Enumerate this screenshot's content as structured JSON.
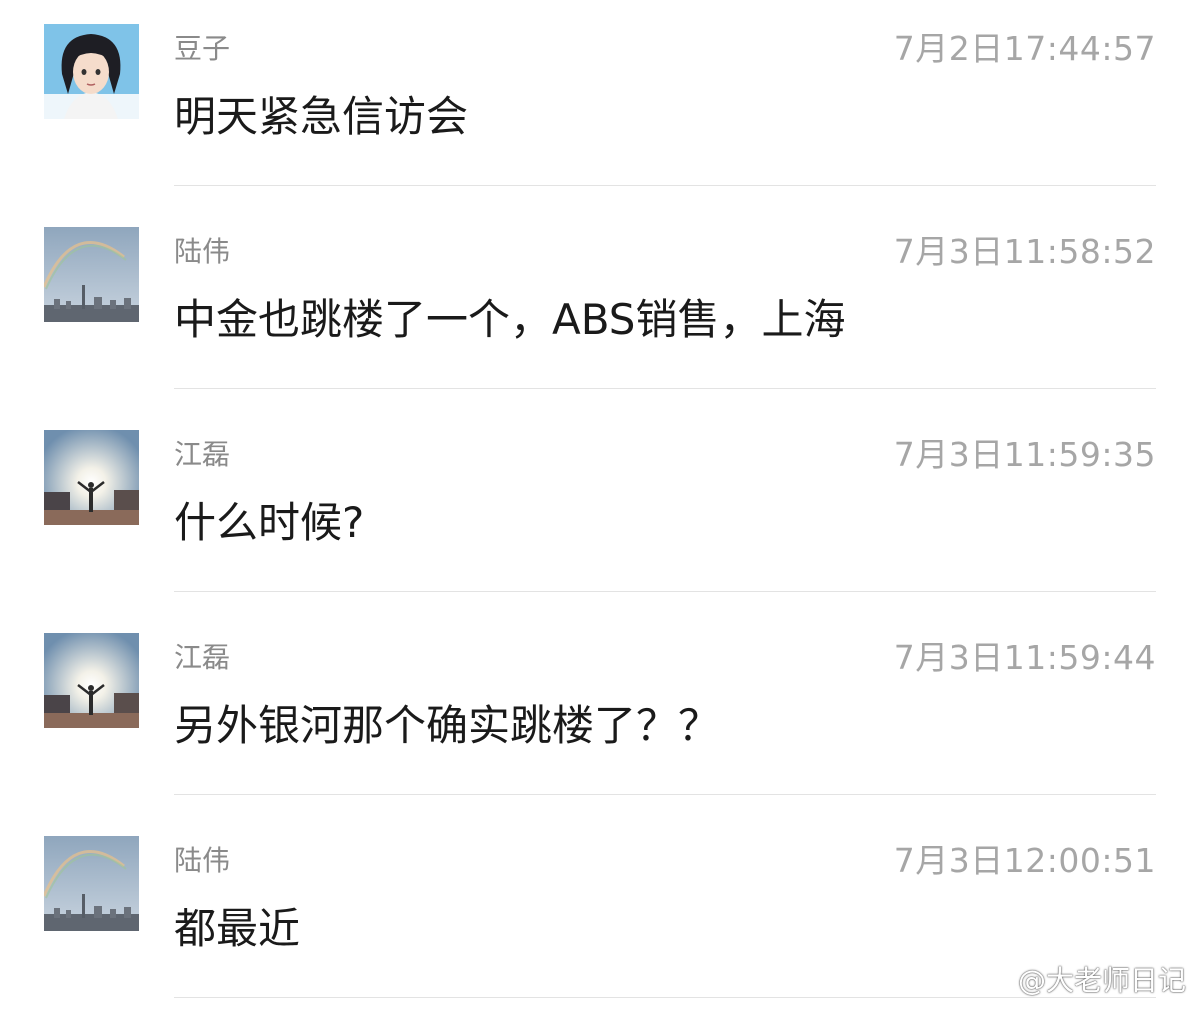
{
  "messages": [
    {
      "sender": "豆子",
      "time": "7月2日17:44:57",
      "text": "明天紧急信访会",
      "avatar": "anime-girl-avatar"
    },
    {
      "sender": "陆伟",
      "time": "7月3日11:58:52",
      "text": "中金也跳楼了一个，ABS销售，上海",
      "avatar": "rainbow-city-avatar"
    },
    {
      "sender": "江磊",
      "time": "7月3日11:59:35",
      "text": "什么时候?",
      "avatar": "sunset-person-avatar"
    },
    {
      "sender": "江磊",
      "time": "7月3日11:59:44",
      "text": "另外银河那个确实跳楼了？？",
      "avatar": "sunset-person-avatar"
    },
    {
      "sender": "陆伟",
      "time": "7月3日12:00:51",
      "text": "都最近",
      "avatar": "rainbow-city-avatar"
    }
  ],
  "watermark": {
    "text": "@大老师日记",
    "icon": "weibo-logo-icon"
  }
}
